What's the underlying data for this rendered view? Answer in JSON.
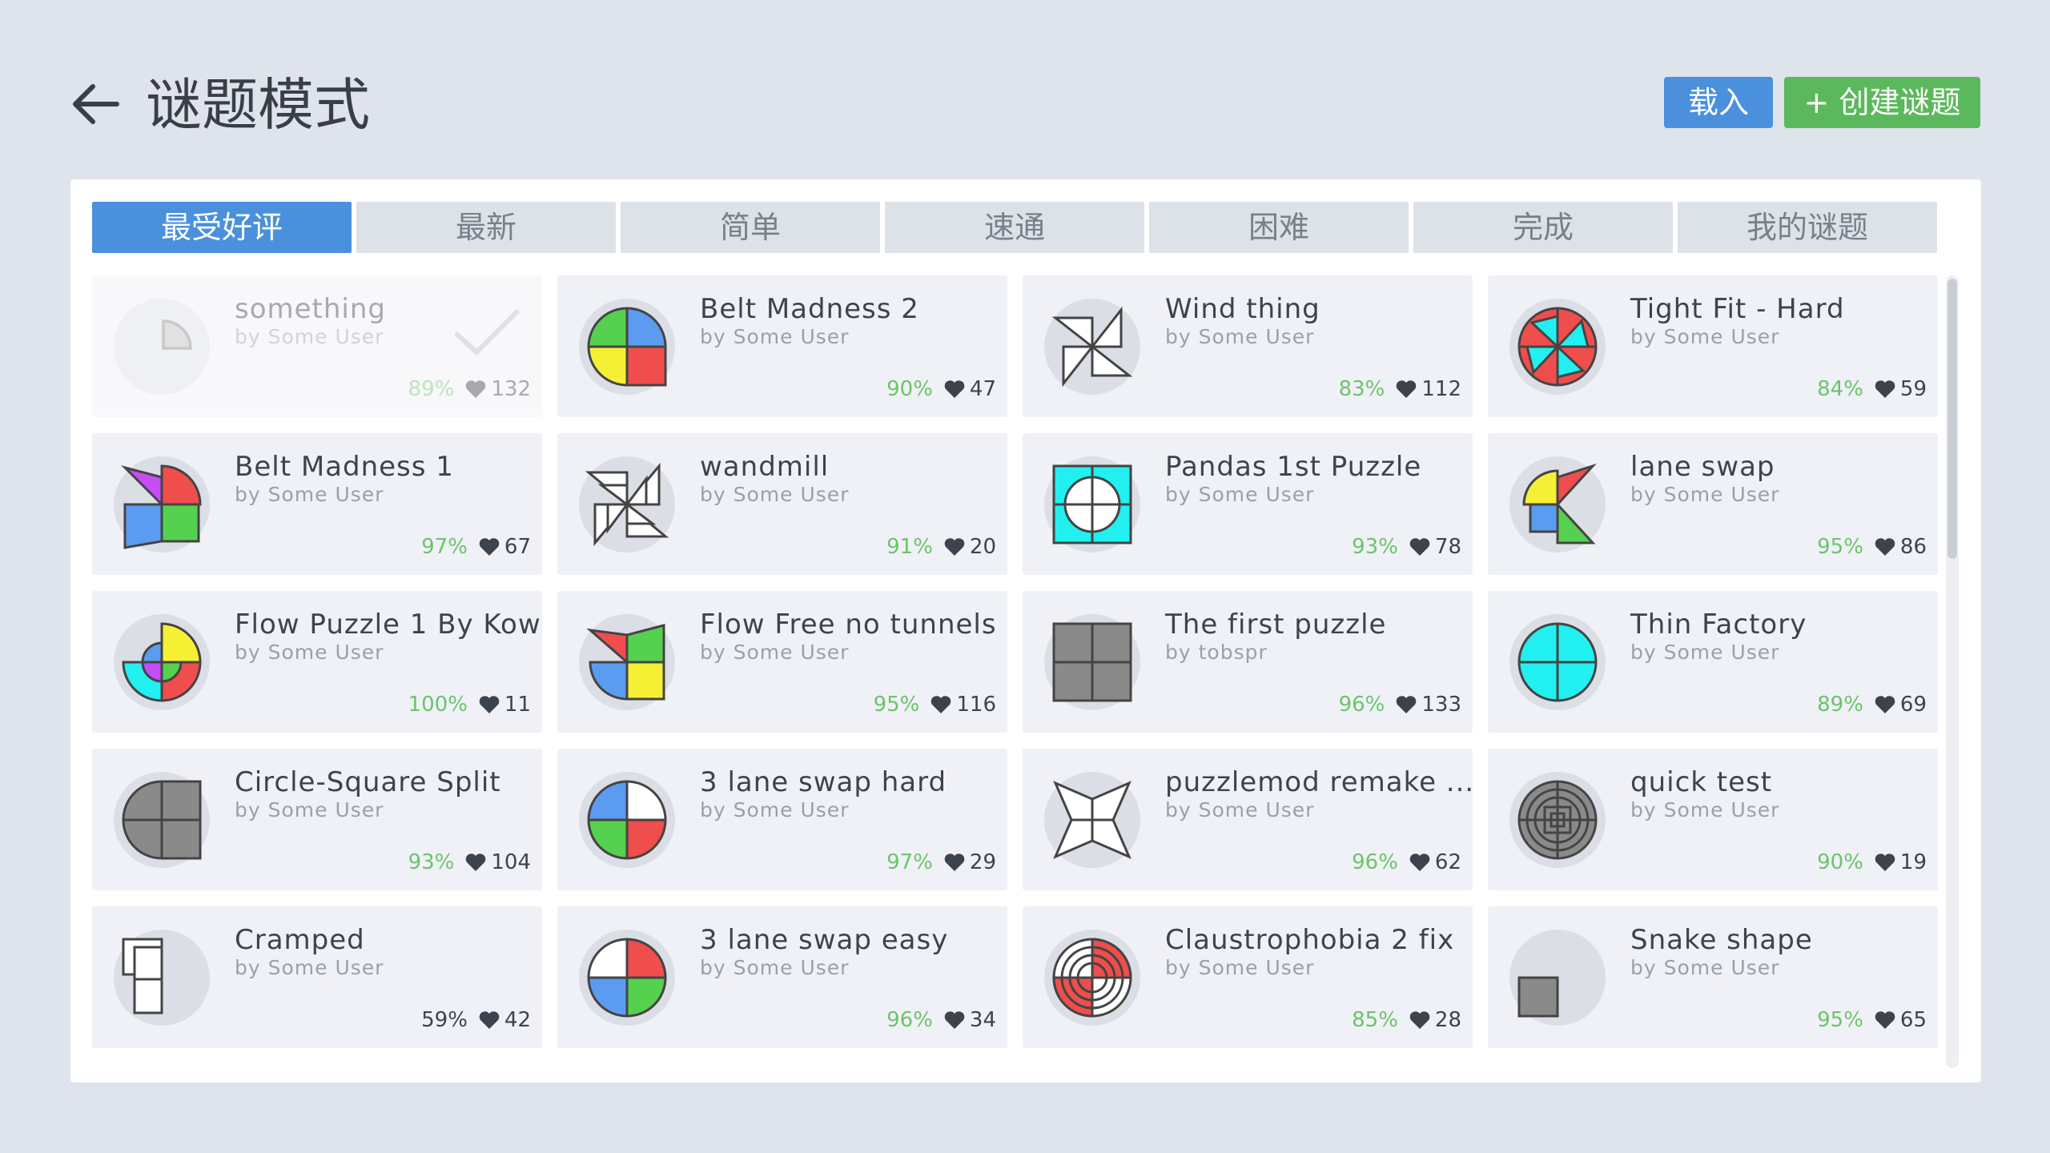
{
  "header": {
    "title": "谜题模式",
    "load_label": "载入",
    "create_label": "+ 创建谜题"
  },
  "tabs": [
    {
      "label": "最受好评",
      "active": true
    },
    {
      "label": "最新"
    },
    {
      "label": "简单"
    },
    {
      "label": "速通"
    },
    {
      "label": "困难"
    },
    {
      "label": "完成"
    },
    {
      "label": "我的谜题"
    }
  ],
  "puzzles": [
    {
      "title": "something",
      "author": "by Some User",
      "rating": "89%",
      "likes": "132",
      "completed": true,
      "icon": "quarter-sector-shape-icon"
    },
    {
      "title": "Belt Madness 2",
      "author": "by Some User",
      "rating": "90%",
      "likes": "47",
      "icon": "four-color-shape-icon"
    },
    {
      "title": "Wind thing",
      "author": "by Some User",
      "rating": "83%",
      "likes": "112",
      "icon": "windmill-shape-icon"
    },
    {
      "title": "Tight Fit - Hard",
      "author": "by Some User",
      "rating": "84%",
      "likes": "59",
      "icon": "red-cyan-star-shape-icon"
    },
    {
      "title": "Belt Madness 1",
      "author": "by Some User",
      "rating": "97%",
      "likes": "67",
      "icon": "mixed-color-shape-icon"
    },
    {
      "title": "wandmill",
      "author": "by Some User",
      "rating": "91%",
      "likes": "20",
      "icon": "layered-windmill-shape-icon"
    },
    {
      "title": "Pandas 1st Puzzle",
      "author": "by Some User",
      "rating": "93%",
      "likes": "78",
      "icon": "cyan-square-circle-shape-icon"
    },
    {
      "title": "lane swap",
      "author": "by Some User",
      "rating": "95%",
      "likes": "86",
      "icon": "lane-swap-shape-icon"
    },
    {
      "title": "Flow Puzzle 1 By Kow",
      "author": "by Some User",
      "rating": "100%",
      "likes": "11",
      "icon": "layered-circle-shape-icon"
    },
    {
      "title": "Flow Free no tunnels",
      "author": "by Some User",
      "rating": "95%",
      "likes": "116",
      "icon": "flow-shape-icon"
    },
    {
      "title": "The first puzzle",
      "author": "by tobspr",
      "rating": "96%",
      "likes": "133",
      "icon": "gray-square-shape-icon"
    },
    {
      "title": "Thin Factory",
      "author": "by Some User",
      "rating": "89%",
      "likes": "69",
      "icon": "cyan-circle-shape-icon"
    },
    {
      "title": "Circle-Square Split",
      "author": "by Some User",
      "rating": "93%",
      "likes": "104",
      "icon": "circle-square-shape-icon"
    },
    {
      "title": "3 lane swap hard",
      "author": "by Some User",
      "rating": "97%",
      "likes": "29",
      "icon": "three-color-circle-shape-icon"
    },
    {
      "title": "puzzlemod remake ...",
      "author": "by Some User",
      "rating": "96%",
      "likes": "62",
      "icon": "star-shape-icon"
    },
    {
      "title": "quick test",
      "author": "by Some User",
      "rating": "90%",
      "likes": "19",
      "icon": "concentric-rings-shape-icon"
    },
    {
      "title": "Cramped",
      "author": "by Some User",
      "rating": "59%",
      "likes": "42",
      "icon": "small-rects-shape-icon"
    },
    {
      "title": "3 lane swap easy",
      "author": "by Some User",
      "rating": "96%",
      "likes": "34",
      "icon": "four-color-circle-shape-icon"
    },
    {
      "title": "Claustrophobia 2 fix",
      "author": "by Some User",
      "rating": "85%",
      "likes": "28",
      "icon": "red-rings-shape-icon"
    },
    {
      "title": "Snake shape",
      "author": "by Some User",
      "rating": "95%",
      "likes": "65",
      "icon": "small-square-shape-icon"
    }
  ],
  "colors": {
    "accent": "#4a90dc",
    "create": "#5cb85c",
    "rating_good": "#6cc46b",
    "shape_red": "#f04d4d",
    "shape_green": "#56d14f",
    "shape_blue": "#5b9cf0",
    "shape_yellow": "#f5f033",
    "shape_cyan": "#22f0f0",
    "shape_purple": "#c64df5",
    "shape_gray": "#8a8a8a"
  }
}
